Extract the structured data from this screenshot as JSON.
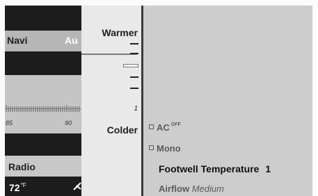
{
  "left_panel": {
    "navi_label": "Navi",
    "navi_extra": "Au",
    "scale_left": "85",
    "scale_right": "90",
    "radio_label": "Radio",
    "temperature": "72",
    "temperature_unit": "°F",
    "fan_icon": "fan-icon"
  },
  "temp_column": {
    "warmer_label": "Warmer",
    "colder_label": "Colder",
    "level_number": "1"
  },
  "menu": {
    "ac_label": "AC",
    "ac_state": "OFF",
    "mono_label": "Mono",
    "footwell_label": "Footwell Temperature",
    "footwell_value": "1",
    "airflow_label": "Airflow",
    "airflow_value": "Medium"
  },
  "colors": {
    "dark_band": "#1c1c1c",
    "panel_bg": "#cdcdcd",
    "text_dark": "#1e1e1e"
  }
}
